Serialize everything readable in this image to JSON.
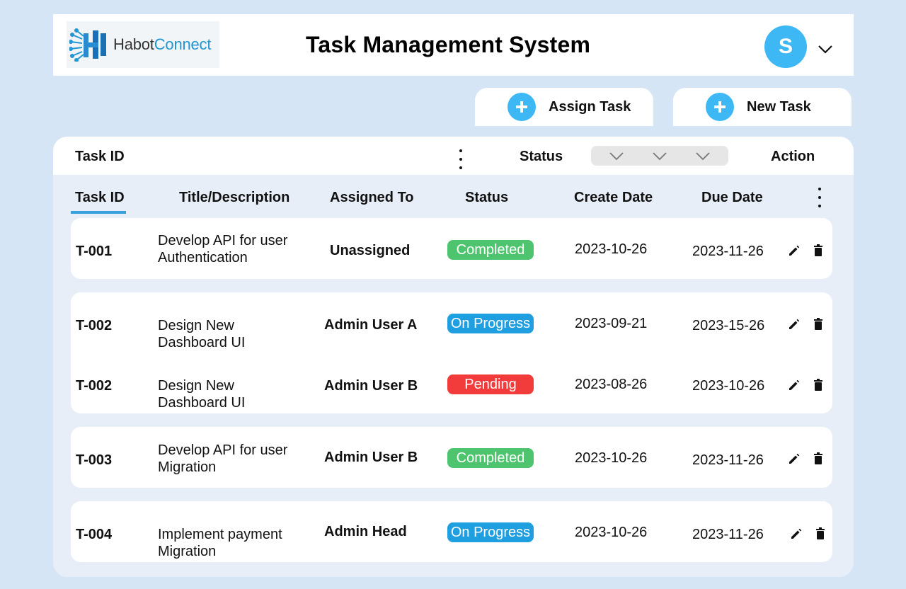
{
  "brand": {
    "name_part1": "Habot",
    "name_part2": "Connect"
  },
  "header": {
    "title": "Task Management System",
    "avatar_initial": "S"
  },
  "actions": {
    "assign_label": "Assign Task",
    "new_label": "New Task"
  },
  "filter": {
    "task_id_label": "Task ID",
    "status_label": "Status",
    "action_label": "Action"
  },
  "columns": [
    "Task ID",
    "Title/Description",
    "Assigned To",
    "Status",
    "Create Date",
    "Due Date"
  ],
  "tasks": [
    {
      "id": "T-001",
      "title": "Develop API for user Authentication",
      "assigned": "Unassigned",
      "status": "Completed",
      "created": "2023-10-26",
      "due": "2023-11-26"
    },
    {
      "id": "T-002",
      "title": "Design New Dashboard UI",
      "assigned": "Admin User A",
      "status": "On Progress",
      "created": "2023-09-21",
      "due": "2023-15-26"
    },
    {
      "id": "T-002",
      "title": "Design New Dashboard UI",
      "assigned": "Admin User B",
      "status": "Pending",
      "created": "2023-08-26",
      "due": "2023-10-26"
    },
    {
      "id": "T-003",
      "title": "Develop API for user Migration",
      "assigned": "Admin User B",
      "status": "Completed",
      "created": "2023-10-26",
      "due": "2023-11-26"
    },
    {
      "id": "T-004",
      "title": "Implement payment Migration",
      "assigned": "Admin Head",
      "status": "On Progress",
      "created": "2023-10-26",
      "due": "2023-11-26"
    }
  ],
  "status_colors": {
    "Completed": "#4fc46e",
    "On Progress": "#1f9fe0",
    "Pending": "#f23c3c"
  },
  "colors": {
    "accent": "#3db8f5",
    "background": "#d6e5f5",
    "panel": "#e8eef8"
  },
  "icons": {
    "edit": "pencil-icon",
    "delete": "trash-icon",
    "add": "plus-icon",
    "dropdown": "chevron-down-icon",
    "more": "kebab-icon"
  }
}
